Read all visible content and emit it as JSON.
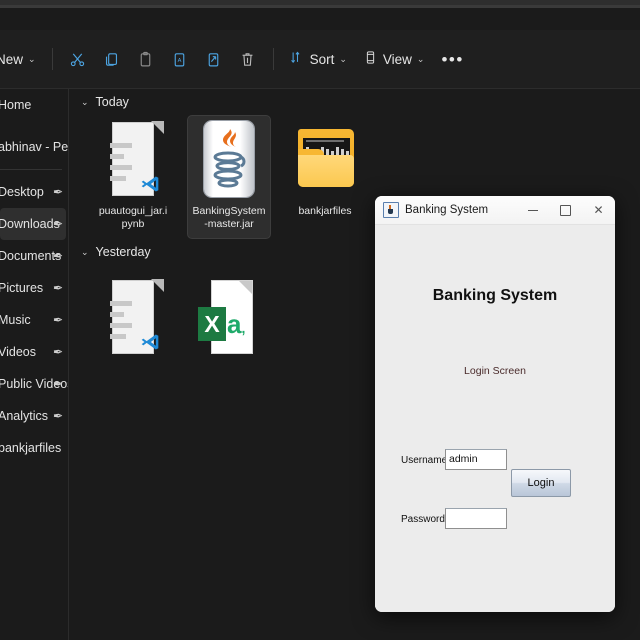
{
  "explorer": {
    "command_bar": {
      "new_label": "New",
      "new_chevron": "chevron-down",
      "buttons": [
        {
          "name": "cut-button",
          "icon": "scissors-icon",
          "tooltip": "Cut"
        },
        {
          "name": "copy-button",
          "icon": "copy-icon",
          "tooltip": "Copy"
        },
        {
          "name": "paste-button",
          "icon": "paste-icon",
          "tooltip": "Paste"
        },
        {
          "name": "rename-button",
          "icon": "rename-icon",
          "tooltip": "Rename"
        },
        {
          "name": "share-button",
          "icon": "share-icon",
          "tooltip": "Share"
        },
        {
          "name": "delete-button",
          "icon": "trash-icon",
          "tooltip": "Delete"
        }
      ],
      "sort_label": "Sort",
      "sort_icon": "sort-icon",
      "view_label": "View",
      "view_icon": "view-icon",
      "overflow_label": "•••"
    },
    "sidebar": {
      "items": [
        {
          "label": "Home",
          "pinned": false,
          "selected": false,
          "divider_after": false
        },
        {
          "label": "abhinav - Personal",
          "pinned": false,
          "selected": false,
          "divider_after": true
        },
        {
          "label": "Desktop",
          "pinned": true,
          "selected": false,
          "divider_after": false
        },
        {
          "label": "Downloads",
          "pinned": true,
          "selected": true,
          "divider_after": false
        },
        {
          "label": "Documents",
          "pinned": true,
          "selected": false,
          "divider_after": false
        },
        {
          "label": "Pictures",
          "pinned": true,
          "selected": false,
          "divider_after": false
        },
        {
          "label": "Music",
          "pinned": true,
          "selected": false,
          "divider_after": false
        },
        {
          "label": "Videos",
          "pinned": true,
          "selected": false,
          "divider_after": false
        },
        {
          "label": "Public Videos",
          "pinned": true,
          "selected": false,
          "divider_after": false
        },
        {
          "label": "Analytics",
          "pinned": true,
          "selected": false,
          "divider_after": false
        },
        {
          "label": "bankjarfiles",
          "pinned": false,
          "selected": false,
          "divider_after": false
        }
      ],
      "pin_glyph": "✒"
    },
    "groups": [
      {
        "header": "Today",
        "chevron": "˅",
        "files": [
          {
            "name": "puautogui_jar.ipynb",
            "icon": "ipynb-document-icon",
            "selected": false
          },
          {
            "name": "BankingSystem-master.jar",
            "icon": "java-jar-icon",
            "selected": true
          },
          {
            "name": "bankjarfiles",
            "icon": "folder-icon",
            "selected": false
          }
        ]
      },
      {
        "header": "Yesterday",
        "chevron": "˅",
        "files": [
          {
            "name": "",
            "icon": "ipynb-document-icon",
            "selected": false
          },
          {
            "name": "",
            "icon": "excel-document-icon",
            "selected": false
          }
        ]
      }
    ]
  },
  "dialog": {
    "title": "Banking System",
    "title_icon": "java-coffee-cup-icon",
    "window_buttons": {
      "minimize": "–",
      "maximize": "□",
      "close": "✕"
    },
    "heading": "Banking System",
    "subheading": "Login Screen",
    "fields": [
      {
        "label": "Username:",
        "value": "admin",
        "type": "text"
      },
      {
        "label": "Password:",
        "value": "",
        "type": "password"
      }
    ],
    "login_button": "Login"
  },
  "colors": {
    "window_bg": "#1b1b1b",
    "command_bar_bg": "#1f1f1f",
    "accent_blue": "#4ca3e0",
    "selection_bg": "#2f2f2f",
    "dialog_bg": "#ececec",
    "subheading_color": "#4a2b2b",
    "folder_yellow": "#f7b733",
    "excel_green": "#1d7a42",
    "java_orange": "#e76f1d"
  }
}
